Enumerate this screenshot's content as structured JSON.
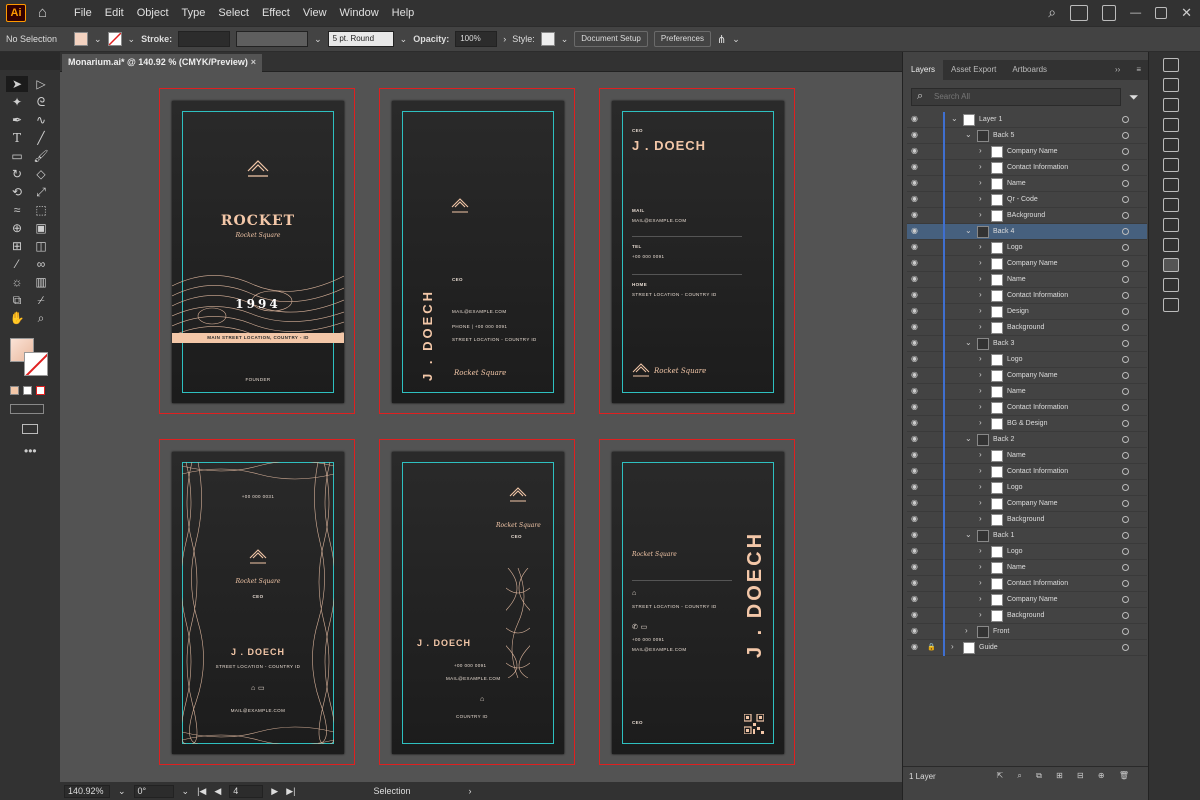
{
  "app": {
    "logo": "Ai",
    "menus": [
      "File",
      "Edit",
      "Object",
      "Type",
      "Select",
      "Effect",
      "View",
      "Window",
      "Help"
    ]
  },
  "control": {
    "selection": "No Selection",
    "stroke_label": "Stroke:",
    "brush": "5 pt. Round",
    "opacity_label": "Opacity:",
    "opacity": "100%",
    "style_label": "Style:",
    "doc_setup": "Document Setup",
    "preferences": "Preferences"
  },
  "document": {
    "tab": "Monarium.ai* @ 140.92 % (CMYK/Preview)"
  },
  "status": {
    "zoom": "140.92%",
    "rotate": "0°",
    "artboard": "4",
    "tool": "Selection"
  },
  "cards": {
    "rocket": "ROCKET",
    "rocket_sub": "Rocket Square",
    "year": "1994",
    "address": "MAIN STREET LOCATION, COUNTRY - ID",
    "founder": "FOUNDER",
    "name": "J . DOECH",
    "ceo": "CEO",
    "mail": "MAIL@EXAMPLE.COM",
    "phone_line": "PHONE | +00 000 0091",
    "street_line": "STREET LOCATION - COUNTRY ID",
    "mail_label": "MAIL",
    "tel_label": "TEL",
    "tel": "+00 000 0091",
    "home_label": "HOME",
    "street": "STREET LOCATION - COUNTRY ID",
    "phone": "+00 000 0091",
    "phone2": "+00 000 0031",
    "country": "COUNTRY ID"
  },
  "panel": {
    "tabs": [
      "Layers",
      "Asset Export",
      "Artboards"
    ],
    "search": "Search All",
    "footer": "1 Layer",
    "rows": [
      {
        "name": "Layer 1",
        "level": 0,
        "open": true
      },
      {
        "name": "Back 5",
        "level": 1,
        "open": true
      },
      {
        "name": "Company Name",
        "level": 2
      },
      {
        "name": "Contact Information",
        "level": 2
      },
      {
        "name": "Name",
        "level": 2
      },
      {
        "name": "Qr - Code",
        "level": 2
      },
      {
        "name": "BAckground",
        "level": 2
      },
      {
        "name": "Back 4",
        "level": 1,
        "open": true,
        "selected": true
      },
      {
        "name": "Logo",
        "level": 2
      },
      {
        "name": "Company Name",
        "level": 2
      },
      {
        "name": "Name",
        "level": 2
      },
      {
        "name": "Contact Information",
        "level": 2
      },
      {
        "name": "Design",
        "level": 2
      },
      {
        "name": "Background",
        "level": 2
      },
      {
        "name": "Back 3",
        "level": 1,
        "open": true
      },
      {
        "name": "Logo",
        "level": 2
      },
      {
        "name": "Company Name",
        "level": 2
      },
      {
        "name": "Name",
        "level": 2
      },
      {
        "name": "Contact Information",
        "level": 2
      },
      {
        "name": "BG & Design",
        "level": 2
      },
      {
        "name": "Back 2",
        "level": 1,
        "open": true
      },
      {
        "name": "Name",
        "level": 2
      },
      {
        "name": "Contact Information",
        "level": 2
      },
      {
        "name": "Logo",
        "level": 2
      },
      {
        "name": "Company Name",
        "level": 2
      },
      {
        "name": "Background",
        "level": 2
      },
      {
        "name": "Back 1",
        "level": 1,
        "open": true
      },
      {
        "name": "Logo",
        "level": 2
      },
      {
        "name": "Name",
        "level": 2
      },
      {
        "name": "Contact Information",
        "level": 2
      },
      {
        "name": "Company Name",
        "level": 2
      },
      {
        "name": "Background",
        "level": 2
      },
      {
        "name": "Front",
        "level": 1
      },
      {
        "name": "Guide",
        "level": 0,
        "locked": true
      }
    ]
  },
  "colors": {
    "accent": "#f3c7a8",
    "guide": "#2ec0c0",
    "artboard_border": "#e02020",
    "selection": "#46607e"
  }
}
